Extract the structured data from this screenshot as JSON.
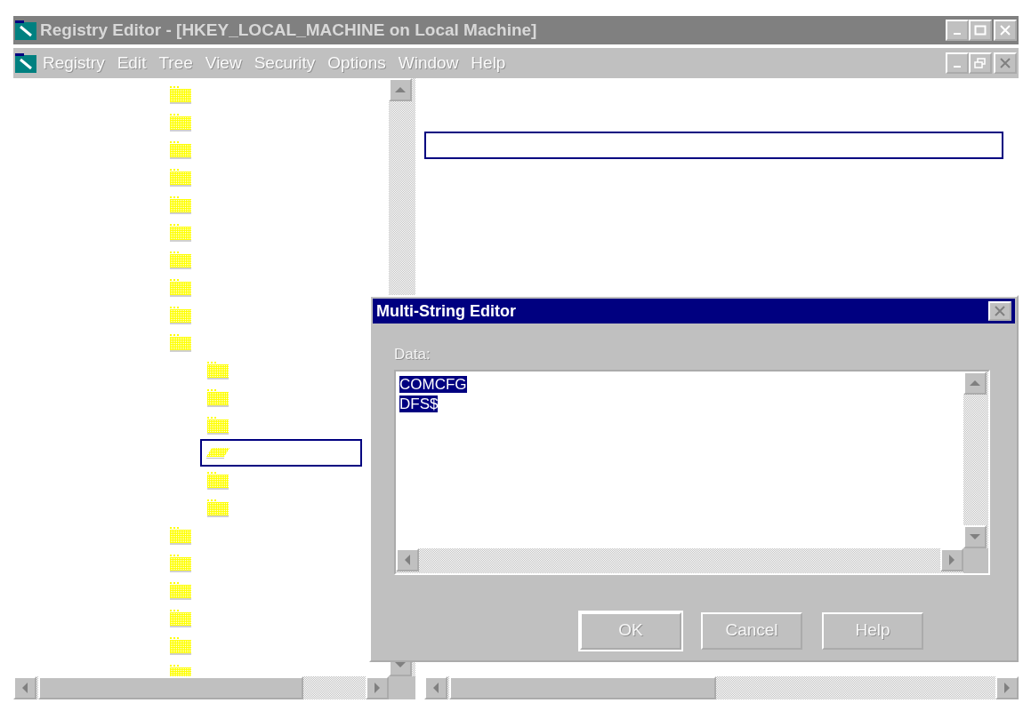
{
  "window": {
    "title": "Registry Editor - [HKEY_LOCAL_MACHINE on Local Machine]"
  },
  "menu": [
    {
      "label": "Registry"
    },
    {
      "label": "Edit"
    },
    {
      "label": "Tree"
    },
    {
      "label": "View"
    },
    {
      "label": "Security"
    },
    {
      "label": "Options"
    },
    {
      "label": "Window"
    },
    {
      "label": "Help"
    }
  ],
  "tree": [
    {
      "selected": false
    },
    {
      "selected": false
    },
    {
      "selected": false
    },
    {
      "selected": false
    },
    {
      "selected": false
    },
    {
      "selected": false
    },
    {
      "selected": false
    },
    {
      "selected": false
    },
    {
      "selected": false
    },
    {
      "selected": false,
      "children": [
        {
          "selected": false
        },
        {
          "selected": false
        },
        {
          "selected": false
        },
        {
          "selected": true
        },
        {
          "selected": false
        },
        {
          "selected": false
        }
      ]
    },
    {
      "selected": false
    },
    {
      "selected": false
    },
    {
      "selected": false
    },
    {
      "selected": false
    },
    {
      "selected": false
    },
    {
      "selected": false
    }
  ],
  "dialog": {
    "title": "Multi-String Editor",
    "label": "Data:",
    "lines": [
      "COMCFG",
      "DFS$"
    ],
    "text_selected": true,
    "buttons": [
      {
        "label": "OK",
        "default": true
      },
      {
        "label": "Cancel",
        "default": false
      },
      {
        "label": "Help",
        "default": false
      }
    ]
  }
}
